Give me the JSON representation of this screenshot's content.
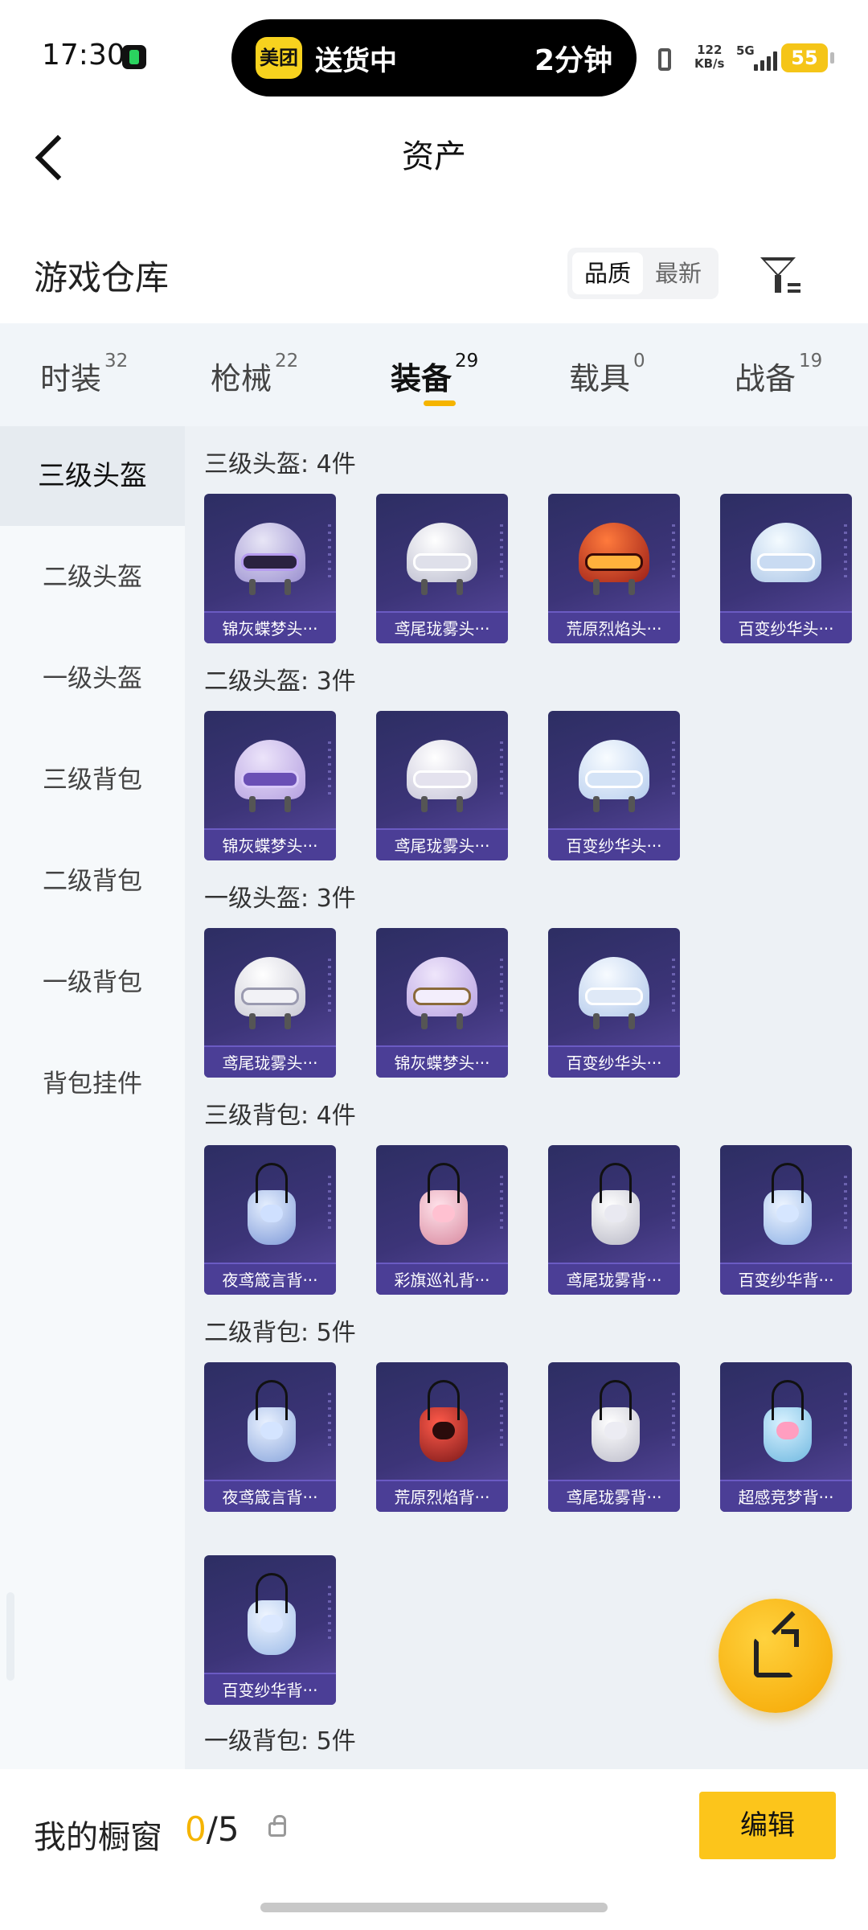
{
  "status_bar": {
    "time": "17:30",
    "island_brand": "美团",
    "island_status": "送货中",
    "island_eta": "2分钟",
    "net_speed_value": "122",
    "net_speed_unit": "KB/s",
    "network": "5G",
    "battery": "55"
  },
  "nav": {
    "title": "资产"
  },
  "warehouse": {
    "title": "游戏仓库",
    "sort_options": [
      "品质",
      "最新"
    ],
    "selected_sort": "品质"
  },
  "tabs": [
    {
      "label": "时装",
      "count": "32"
    },
    {
      "label": "枪械",
      "count": "22"
    },
    {
      "label": "装备",
      "count": "29",
      "active": true
    },
    {
      "label": "载具",
      "count": "0"
    },
    {
      "label": "战备",
      "count": "19"
    }
  ],
  "sidebar": {
    "items": [
      "三级头盔",
      "二级头盔",
      "一级头盔",
      "三级背包",
      "二级背包",
      "一级背包",
      "背包挂件"
    ],
    "active": "三级头盔"
  },
  "sections": [
    {
      "title": "三级头盔: 4件",
      "items": [
        "锦灰蝶梦头···",
        "鸢尾珑雾头···",
        "荒原烈焰头···",
        "百变纱华头···"
      ]
    },
    {
      "title": "二级头盔: 3件",
      "items": [
        "锦灰蝶梦头···",
        "鸢尾珑雾头···",
        "百变纱华头···"
      ]
    },
    {
      "title": "一级头盔: 3件",
      "items": [
        "鸢尾珑雾头···",
        "锦灰蝶梦头···",
        "百变纱华头···"
      ]
    },
    {
      "title": "三级背包: 4件",
      "items": [
        "夜鸢箴言背···",
        "彩旗巡礼背···",
        "鸢尾珑雾背···",
        "百变纱华背···"
      ]
    },
    {
      "title": "二级背包: 5件",
      "items": [
        "夜鸢箴言背···",
        "荒原烈焰背···",
        "鸢尾珑雾背···",
        "超感竞梦背···",
        "百变纱华背···"
      ]
    },
    {
      "title": "一级背包: 5件",
      "items": []
    }
  ],
  "bottom_bar": {
    "label": "我的橱窗",
    "count_used": "0",
    "count_sep": "/",
    "count_total": "5",
    "edit_label": "编辑"
  },
  "colors": {
    "accent": "#f5b400",
    "card_bg": "#3c3478",
    "card_label_bg": "#4b3e96"
  }
}
